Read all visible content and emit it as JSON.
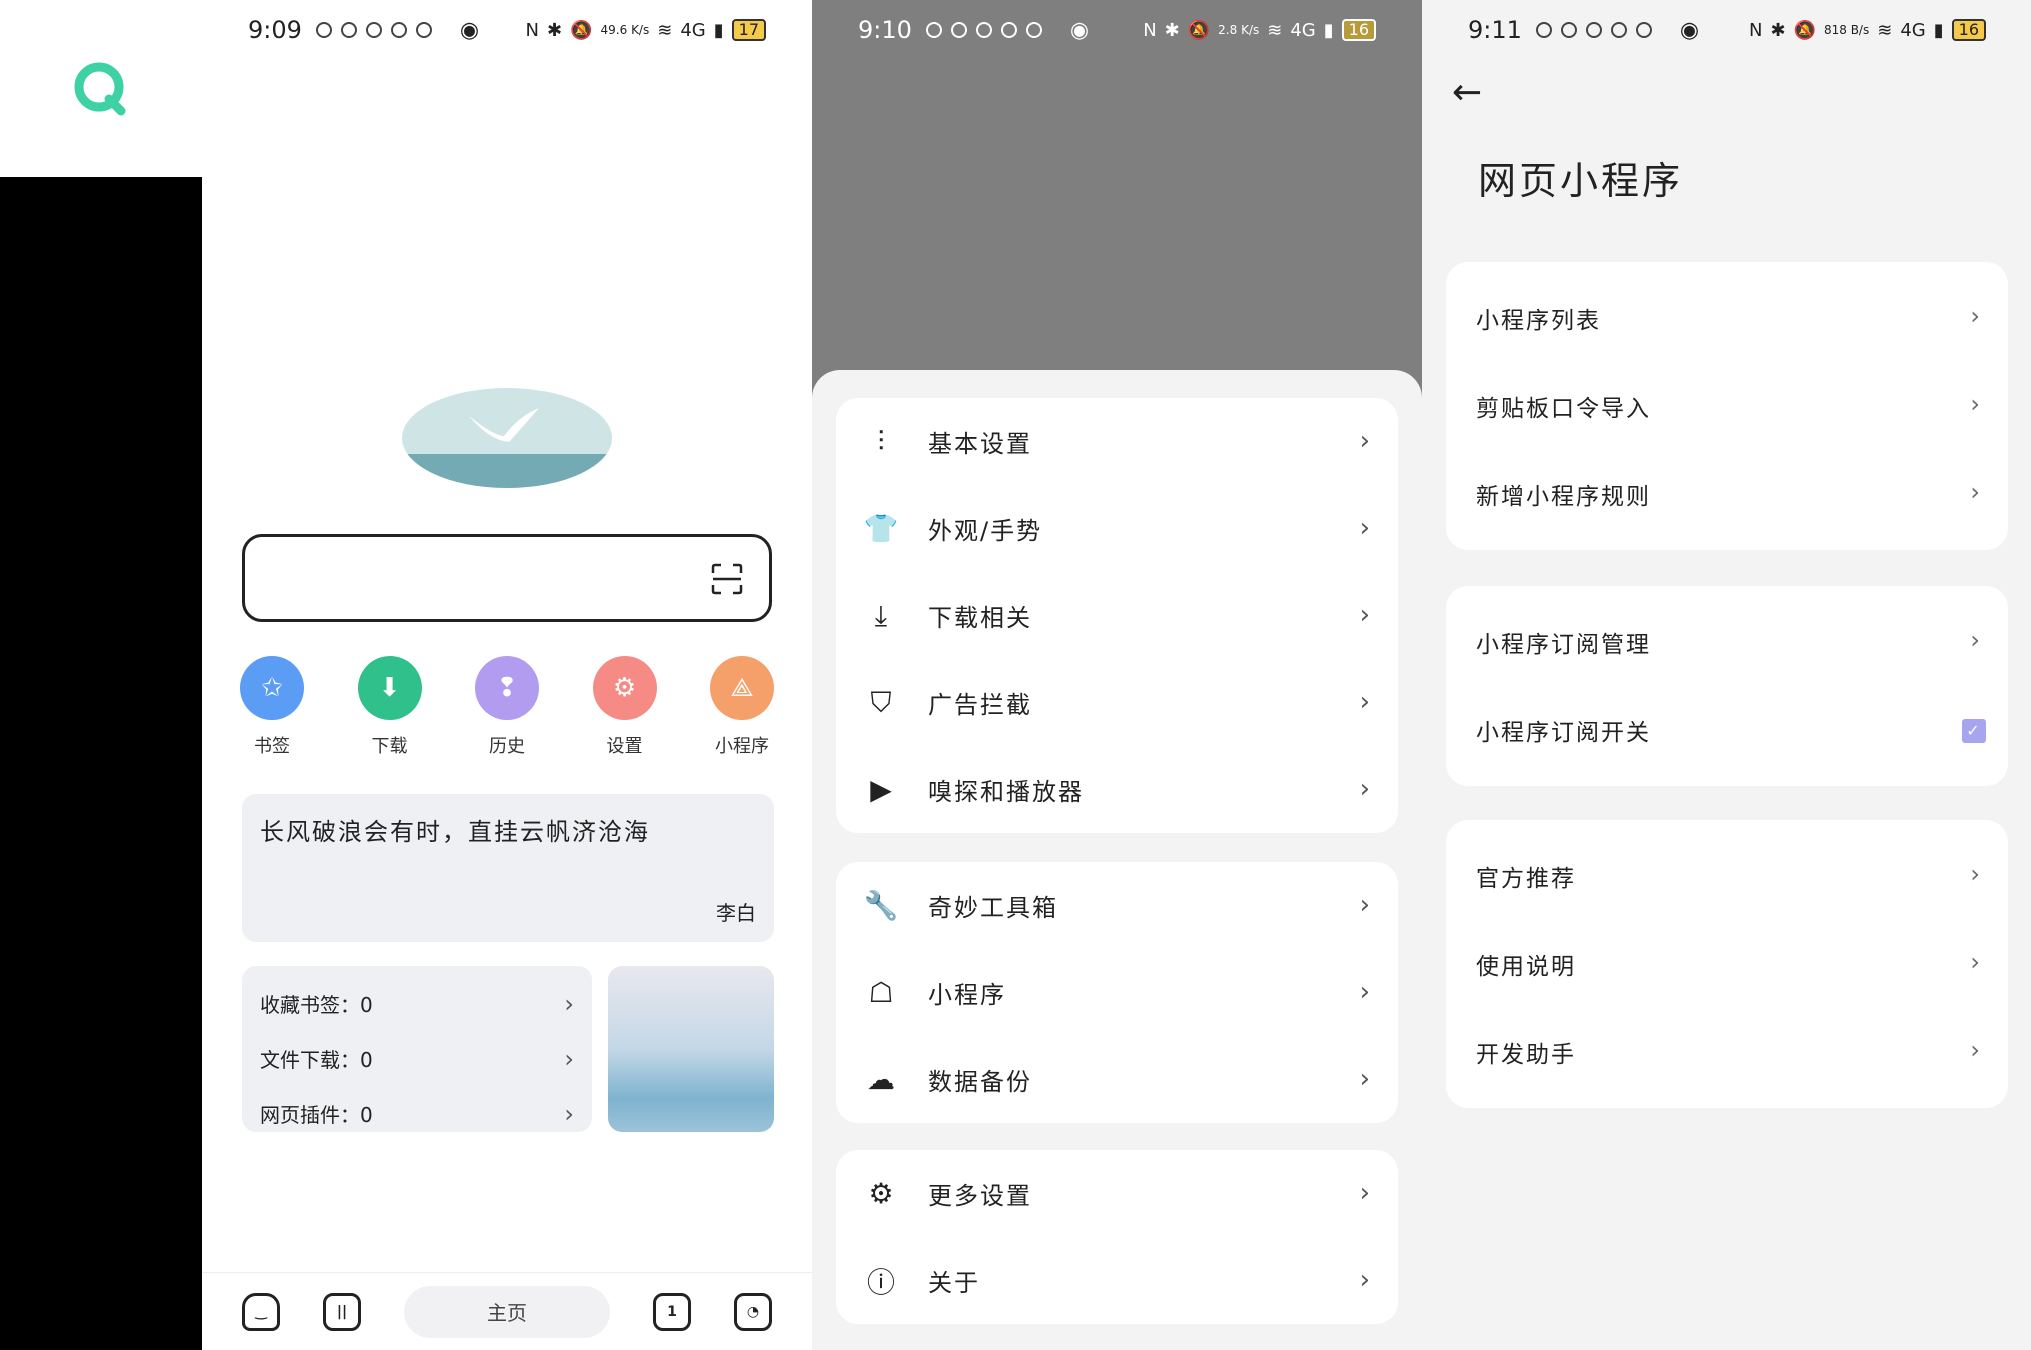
{
  "left_app_icon": "app-logo-icon",
  "panel1": {
    "status": {
      "time": "9:09",
      "speed": "49.6 K/s",
      "battery": "17",
      "network": "4G"
    },
    "search": {
      "placeholder": ""
    },
    "quick_actions": [
      {
        "label": "书签",
        "icon": "star-icon",
        "color": "#5b9cf5"
      },
      {
        "label": "下载",
        "icon": "download-icon",
        "color": "#2fc08c"
      },
      {
        "label": "历史",
        "icon": "footprints-icon",
        "color": "#b19cf0"
      },
      {
        "label": "设置",
        "icon": "gear-icon",
        "color": "#f58b84"
      },
      {
        "label": "小程序",
        "icon": "miniprogram-icon",
        "color": "#f59f6a"
      }
    ],
    "quote": {
      "text": "长风破浪会有时，直挂云帆济沧海",
      "author": "李白"
    },
    "stats": [
      {
        "label": "收藏书签：0"
      },
      {
        "label": "文件下载：0"
      },
      {
        "label": "网页插件：0"
      }
    ],
    "bottom_nav": {
      "home_label": "主页",
      "tabs_count": "1"
    }
  },
  "panel2": {
    "status": {
      "time": "9:10",
      "speed": "2.8 K/s",
      "battery": "16",
      "network": "4G"
    },
    "groups": [
      [
        {
          "label": "基本设置",
          "icon": "sliders-icon"
        },
        {
          "label": "外观/手势",
          "icon": "shirt-icon"
        },
        {
          "label": "下载相关",
          "icon": "download-icon"
        },
        {
          "label": "广告拦截",
          "icon": "shield-icon"
        },
        {
          "label": "嗅探和播放器",
          "icon": "play-icon"
        }
      ],
      [
        {
          "label": "奇妙工具箱",
          "icon": "wrench-icon"
        },
        {
          "label": "小程序",
          "icon": "android-icon"
        },
        {
          "label": "数据备份",
          "icon": "cloud-upload-icon"
        }
      ],
      [
        {
          "label": "更多设置",
          "icon": "gear-icon"
        },
        {
          "label": "关于",
          "icon": "info-icon"
        }
      ]
    ]
  },
  "panel3": {
    "status": {
      "time": "9:11",
      "speed": "818 B/s",
      "battery": "16",
      "network": "4G"
    },
    "title": "网页小程序",
    "groups": [
      [
        {
          "label": "小程序列表"
        },
        {
          "label": "剪贴板口令导入"
        },
        {
          "label": "新增小程序规则"
        }
      ],
      [
        {
          "label": "小程序订阅管理"
        },
        {
          "label": "小程序订阅开关",
          "checked": true
        }
      ],
      [
        {
          "label": "官方推荐"
        },
        {
          "label": "使用说明"
        },
        {
          "label": "开发助手"
        }
      ]
    ]
  }
}
